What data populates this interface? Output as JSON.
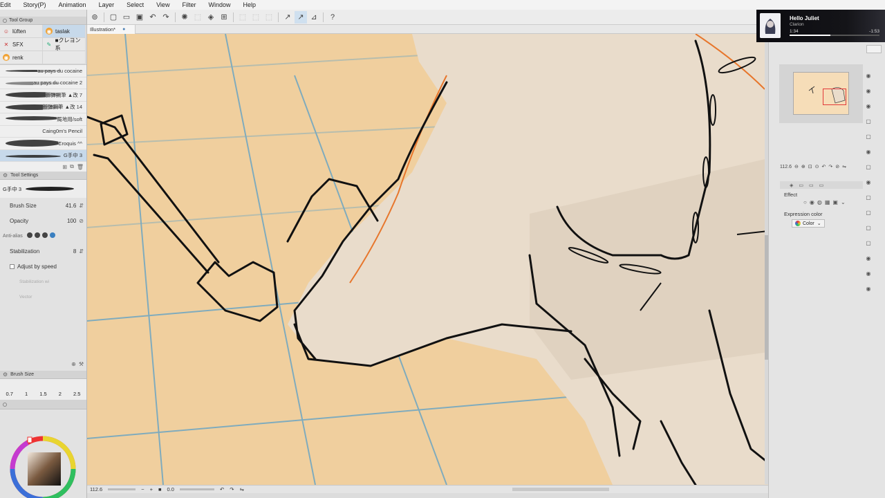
{
  "menu": [
    "Edit",
    "Story(P)",
    "Animation",
    "Layer",
    "Select",
    "View",
    "Filter",
    "Window",
    "Help"
  ],
  "document": {
    "tab_label": "Illustration*",
    "tab_close": "●"
  },
  "left_panel": {
    "tool_group_title": "Tool Group",
    "tool_groups": [
      {
        "icon": "☺",
        "label": "lüften",
        "selected": false
      },
      {
        "icon": "◉",
        "label": "taslak",
        "selected": true
      },
      {
        "icon": "✕",
        "label": "SFX",
        "selected": false
      },
      {
        "icon": "✎",
        "label": "■クレヨン系",
        "selected": false
      },
      {
        "icon": "◉",
        "label": "renk",
        "selected": false
      }
    ],
    "brushes": [
      "au pays du cocaine",
      "au pays du cocaine 2",
      "新弹鋼筆 ▲改 7",
      "新弹鋼筆 ▲改 14",
      "局地用/soft",
      "Caing0m's Pencil",
      "Croquis ^^",
      "G手中 3"
    ],
    "tool_settings_title": "Tool Settings",
    "current_brush": "G手中 3",
    "brush_size_label": "Brush Size",
    "brush_size_value": "41.6",
    "opacity_label": "Opacity",
    "opacity_value": "100",
    "anti_alias_label": "Anti-alias",
    "stabilization_label": "Stabilization",
    "stabilization_value": "8",
    "adjust_speed_label": "Adjust by speed",
    "stabilization_mode_label": "Stabilization wi",
    "vector_label": "Vector",
    "brush_size_panel_title": "Brush Size",
    "brush_presets": [
      "0.7",
      "1",
      "1.5",
      "2",
      "2.5"
    ]
  },
  "status": {
    "zoom": "112.6",
    "rotation": "0.0"
  },
  "media": {
    "title": "Hello Juliet",
    "artist": "Clarion",
    "elapsed": "1:34",
    "remaining": "-1:53",
    "progress": 0.45
  },
  "right_panel": {
    "navigator_zoom": "112.6",
    "effect_label": "Effect",
    "expression_color_label": "Expression color",
    "color_value": "Color"
  },
  "colors": {
    "canvas_bg": "#f0cf9e",
    "skin": "#e9dccb",
    "guide": "#5aa0c8",
    "accent_orange": "#e7762c",
    "selection": "#c7d9ea"
  }
}
